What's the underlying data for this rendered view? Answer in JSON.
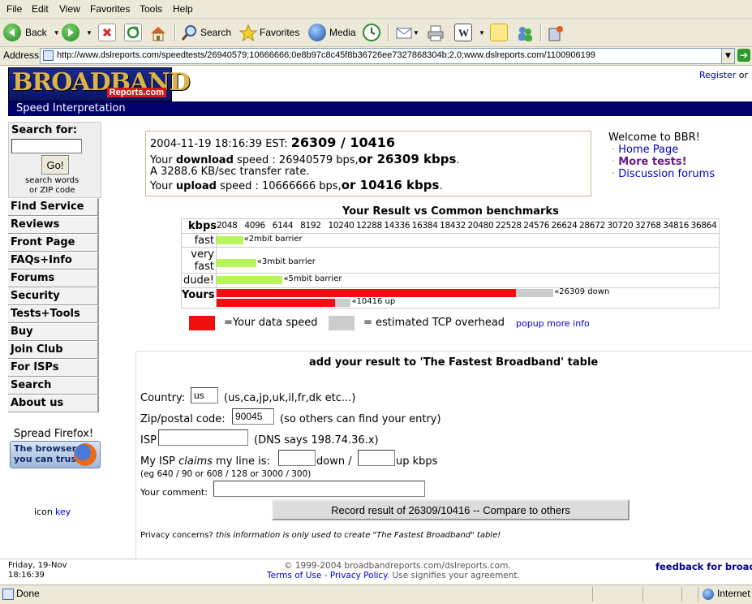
{
  "browser": {
    "menu": [
      "File",
      "Edit",
      "View",
      "Favorites",
      "Tools",
      "Help"
    ],
    "toolbar": {
      "back": "Back",
      "search": "Search",
      "favorites": "Favorites",
      "media": "Media"
    },
    "address_label": "Address",
    "address_url": "http://www.dslreports.com/speedtests/26940579;10666666;0e8b97c8c45f8b36726ee7327868304b;2.0;www.dslreports.com/1100906199",
    "status_text": "Done",
    "zone_text": "Internet"
  },
  "header": {
    "logo_big": "BROADBAND",
    "logo_small": "Reports.com",
    "register_link": "Register",
    "register_or": "or",
    "section_title": "Speed Interpretation"
  },
  "sidebar": {
    "search_label": "Search for:",
    "search_value": "",
    "go_button": "Go!",
    "search_hint_1": "search words",
    "search_hint_2": "or ZIP code",
    "nav": [
      "Find Service",
      "Reviews",
      "Front Page",
      "FAQs+Info",
      "Forums",
      "Security",
      "Tests+Tools",
      "Buy",
      "Join Club",
      "For ISPs",
      "Search",
      "About us"
    ],
    "firefox_title": "Spread Firefox!",
    "firefox_badge_1": "The browser",
    "firefox_badge_2": "you can trust",
    "icon_label": "icon",
    "icon_link": "key"
  },
  "result": {
    "timestamp": "2004-11-19 18:16:39 EST:",
    "headline": "26309 / 10416",
    "line2_pre": "Your",
    "line2_bold": "download",
    "line2_mid": "speed : 26940579 bps,",
    "line2_big": "or 26309 kbps",
    "line2_end": ".",
    "line3": "A 3288.6 KB/sec transfer rate.",
    "line4_pre": "Your",
    "line4_bold": "upload",
    "line4_mid": "speed : 10666666 bps,",
    "line4_big": "or 10416 kbps",
    "line4_end": "."
  },
  "welcome": {
    "title": "Welcome to BBR!",
    "links": [
      "Home Page",
      "More tests!",
      "Discussion forums"
    ]
  },
  "chart_data": {
    "type": "bar",
    "title": "Your Result vs Common benchmarks",
    "xlabel": "kbps",
    "xticks": [
      "2048",
      "4096",
      "6144",
      "8192",
      "10240",
      "12288",
      "14336",
      "16384",
      "18432",
      "20480",
      "22528",
      "24576",
      "26624",
      "28672",
      "30720",
      "32768",
      "34816",
      "36864"
    ],
    "xlim": [
      0,
      38912
    ],
    "rows": [
      {
        "label": "fast",
        "bars": [
          {
            "value": 2048,
            "overhead": 0,
            "color": "#b8f55a",
            "annotation": "«2mbit barrier"
          }
        ]
      },
      {
        "label": "very fast",
        "bars": [
          {
            "value": 3072,
            "overhead": 0,
            "color": "#b8f55a",
            "annotation": "«3mbit barrier"
          }
        ]
      },
      {
        "label": "dude!",
        "bars": [
          {
            "value": 5120,
            "overhead": 0,
            "color": "#b8f55a",
            "annotation": "«5mbit barrier"
          }
        ]
      },
      {
        "label": "Yours",
        "bars": [
          {
            "value": 23200,
            "overhead": 2900,
            "color": "#ee1010",
            "annotation": "«26309 down"
          },
          {
            "value": 9200,
            "overhead": 1200,
            "color": "#ee1010",
            "annotation": "«10416 up"
          }
        ]
      }
    ],
    "legend": [
      {
        "color": "#ee1010",
        "label": "=Your data speed"
      },
      {
        "color": "#cccccc",
        "label": "= estimated TCP overhead"
      }
    ],
    "legend_link": "popup more info"
  },
  "form": {
    "title": "add your result to 'The Fastest Broadband' table",
    "country_label": "Country:",
    "country_value": "us",
    "country_hint": "(us,ca,jp,uk,il,fr,dk etc...)",
    "zip_label": "Zip/postal code:",
    "zip_value": "90045",
    "zip_hint": "(so others can find your entry)",
    "isp_label": "ISP",
    "isp_value": "",
    "isp_hint": "(DNS says 198.74.36.x)",
    "line_label_pre": "My ISP",
    "line_label_em": "claims",
    "line_label_post": "my line is:",
    "down_value": "",
    "down_label": "down /",
    "up_value": "",
    "up_label": "up kbps",
    "line_example": "(eg 640 / 90 or 608 / 128 or 3000 / 300)",
    "comment_label": "Your comment:",
    "comment_value": "",
    "submit_button": "Record result of 26309/10416 -- Compare to others",
    "privacy_pre": "Privacy concerns?",
    "privacy_em": "this information is only used to create \"The Fastest Broadband\" table!"
  },
  "footer": {
    "date_line1": "Friday, 19-Nov",
    "date_line2": "18:16:39",
    "copyright": "© 1999-2004 broadbandreports.com/dslreports.com.",
    "terms_link": "Terms of Use",
    "dash": "-",
    "privacy_link": "Privacy Policy",
    "terms_tail": ". Use signifies your agreement.",
    "feedback_link": "feedback for broadba"
  }
}
